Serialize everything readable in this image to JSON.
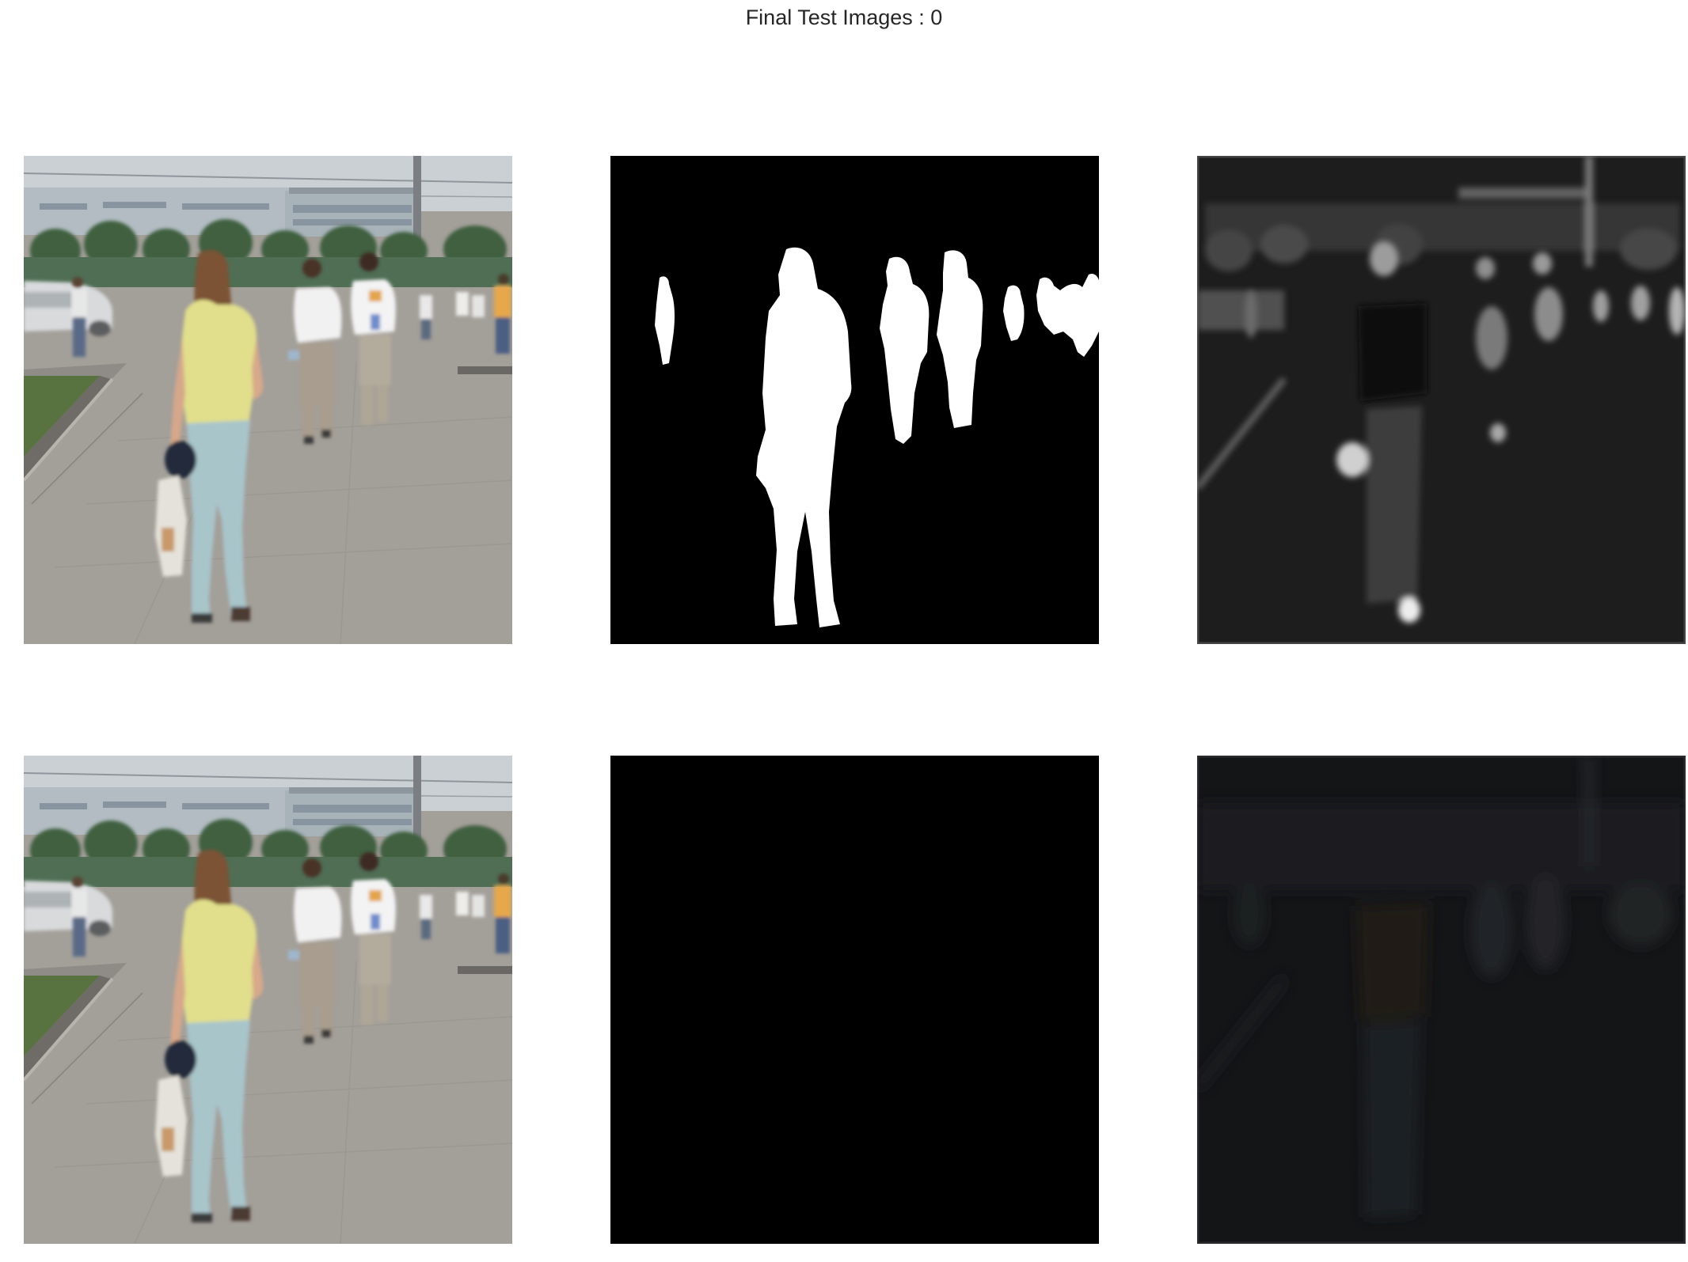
{
  "figure": {
    "title": "Final Test Images : 0"
  },
  "panels": [
    {
      "row": 1,
      "col": 1,
      "content": "input-photo"
    },
    {
      "row": 1,
      "col": 2,
      "content": "binary-mask"
    },
    {
      "row": 1,
      "col": 3,
      "content": "grayscale-feature-map"
    },
    {
      "row": 2,
      "col": 1,
      "content": "input-photo"
    },
    {
      "row": 2,
      "col": 2,
      "content": "masked-photo"
    },
    {
      "row": 2,
      "col": 3,
      "content": "dark-residual-image"
    }
  ],
  "colors": {
    "sky": "#c9ced3",
    "building": "#aeb8be",
    "trees": "#3d5f3f",
    "hedge": "#4b6b50",
    "pavement": "#a09d97",
    "grass": "#56703e",
    "shirt-yellow": "#e0df8a",
    "jeans": "#a9c6cb",
    "hair": "#7a4f33",
    "white-shirt": "#eaeaea",
    "mask-fg": "#ffffff",
    "mask-bg": "#000000",
    "feature-bg": "#1e1e1e",
    "residual-bg": "#141517"
  }
}
